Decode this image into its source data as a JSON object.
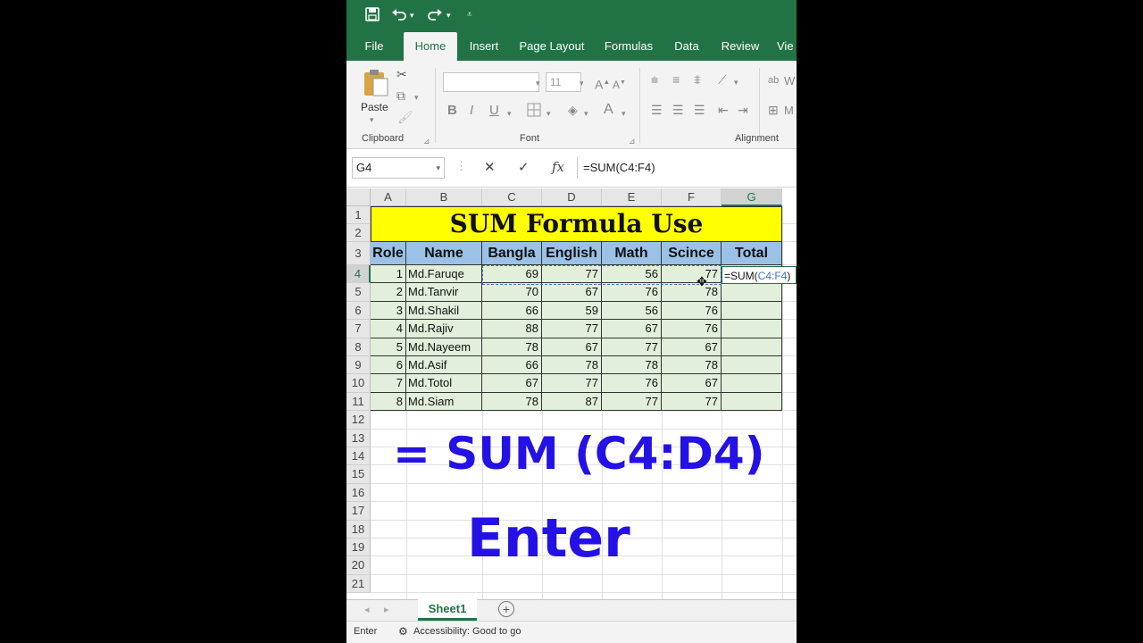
{
  "ribbon": {
    "tabs": [
      "File",
      "Home",
      "Insert",
      "Page Layout",
      "Formulas",
      "Data",
      "Review",
      "Vie"
    ],
    "clipboard": {
      "paste_label": "Paste",
      "group_label": "Clipboard"
    },
    "font": {
      "size_value": "11",
      "group_label": "Font",
      "bold": "B",
      "italic": "I",
      "underline": "U",
      "font_color": "A"
    },
    "alignment": {
      "group_label": "Alignment",
      "wrap_partial": "W",
      "merge_partial": "M"
    }
  },
  "formula_bar": {
    "name_box": "G4",
    "formula": "=SUM(C4:F4)",
    "fx": "fx"
  },
  "columns": [
    "A",
    "B",
    "C",
    "D",
    "E",
    "F",
    "G"
  ],
  "rows": [
    "1",
    "2",
    "3",
    "4",
    "5",
    "6",
    "7",
    "8",
    "9",
    "10",
    "11",
    "12",
    "13",
    "14",
    "15",
    "16",
    "17",
    "18",
    "19",
    "20",
    "21"
  ],
  "sheet": {
    "title": "SUM Formula Use",
    "headers": [
      "Role",
      "Name",
      "Bangla",
      "English",
      "Math",
      "Scince",
      "Total"
    ],
    "records": [
      [
        "1",
        "Md.Faruqe",
        "69",
        "77",
        "56",
        "77"
      ],
      [
        "2",
        "Md.Tanvir",
        "70",
        "67",
        "76",
        "78"
      ],
      [
        "3",
        "Md.Shakil",
        "66",
        "59",
        "56",
        "76"
      ],
      [
        "4",
        "Md.Rajiv",
        "88",
        "77",
        "67",
        "76"
      ],
      [
        "5",
        "Md.Nayeem",
        "78",
        "67",
        "77",
        "67"
      ],
      [
        "6",
        "Md.Asif",
        "66",
        "78",
        "78",
        "78"
      ],
      [
        "7",
        "Md.Totol",
        "67",
        "77",
        "76",
        "67"
      ],
      [
        "8",
        "Md.Siam",
        "78",
        "87",
        "77",
        "77"
      ]
    ],
    "editing_cell": {
      "prefix": "=SUM(",
      "ref": "C4:F4",
      "suffix": ")"
    }
  },
  "overlay": {
    "formula_text": "= SUM  (C4:D4)",
    "enter_text": "Enter"
  },
  "sheet_tabs": {
    "active": "Sheet1",
    "add": "+"
  },
  "status": {
    "mode": "Enter",
    "accessibility": "Accessibility: Good to go"
  },
  "colors": {
    "excel_green": "#217346",
    "title_fill": "#ffff00",
    "header_fill": "#9bc2e6",
    "data_fill": "#e2efda",
    "overlay_text": "#2411e5"
  }
}
